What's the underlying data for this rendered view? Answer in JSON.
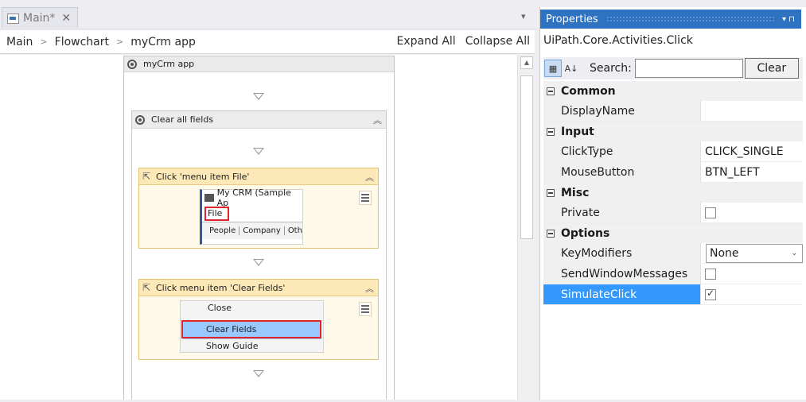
{
  "tab": {
    "label": "Main*",
    "close": "✕"
  },
  "breadcrumb": {
    "items": [
      "Main",
      "Flowchart",
      "myCrm app"
    ],
    "expand_all": "Expand All",
    "collapse_all": "Collapse All"
  },
  "sequence": {
    "title": "myCrm app",
    "inner_title": "Clear all fields",
    "activity1": {
      "title": "Click 'menu item  File'",
      "shot_title": "My CRM (Sample Ap",
      "shot_item": "File",
      "shot_tabs": [
        "People",
        "Company",
        "Oth"
      ]
    },
    "activity2": {
      "title": "Click menu item  'Clear Fields'",
      "menu_items": [
        "Close",
        "Clear Fields",
        "Show Guide"
      ]
    }
  },
  "properties": {
    "title": "Properties",
    "title_controls": "▾  ⊓",
    "type_name": "UiPath.Core.Activities.Click",
    "search_label": "Search:",
    "search_value": "",
    "clear_button": "Clear",
    "categories": [
      {
        "name": "Common",
        "rows": [
          {
            "name": "DisplayName",
            "value": ""
          }
        ]
      },
      {
        "name": "Input",
        "rows": [
          {
            "name": "ClickType",
            "value": "CLICK_SINGLE"
          },
          {
            "name": "MouseButton",
            "value": "BTN_LEFT"
          }
        ]
      },
      {
        "name": "Misc",
        "rows": [
          {
            "name": "Private",
            "checkbox": false
          }
        ]
      },
      {
        "name": "Options",
        "rows": [
          {
            "name": "KeyModifiers",
            "value": "None"
          },
          {
            "name": "SendWindowMessages",
            "checkbox": false
          },
          {
            "name": "SimulateClick",
            "checkbox": true
          }
        ]
      }
    ]
  },
  "colors": {
    "accent": "#2d73c1",
    "selection": "#3399ff",
    "activity_header": "#fde9b8",
    "highlight_red": "#e0262a"
  }
}
